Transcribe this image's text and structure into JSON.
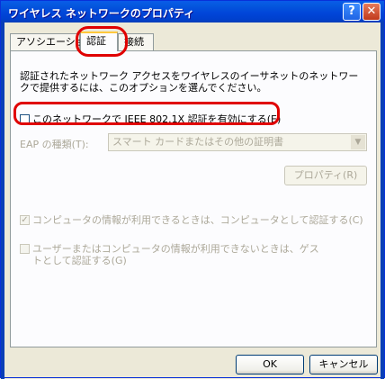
{
  "window": {
    "title": "ワイヤレス ネットワークのプロパティ",
    "help_glyph": "?",
    "close_glyph": "✕"
  },
  "tabs": [
    {
      "label": "アソシエーション"
    },
    {
      "label": "認証"
    },
    {
      "label": "接続"
    }
  ],
  "auth": {
    "description": "認証されたネットワーク アクセスをワイヤレスのイーサネットのネットワークで提供するには、このオプションを選んでください。",
    "ieee_checkbox_label": "このネットワークで IEEE 802.1X 認証を有効にする(E)",
    "ieee_checked": false,
    "eap_label": "EAP の種類(T):",
    "eap_value": "スマート カードまたはその他の証明書",
    "properties_button": "プロパティ(R)",
    "computer_auth_label": "コンピュータの情報が利用できるときは、コンピュータとして認証する(C)",
    "computer_auth_checked": true,
    "guest_auth_label": "ユーザーまたはコンピュータの情報が利用できないときは、ゲストとして認証する(G)",
    "guest_auth_checked": false
  },
  "footer": {
    "ok_label": "OK",
    "cancel_label": "キャンセル"
  },
  "colors": {
    "highlight": "#E00000",
    "titlebar": "#0146D9",
    "dialog_bg": "#ECE9D8"
  }
}
